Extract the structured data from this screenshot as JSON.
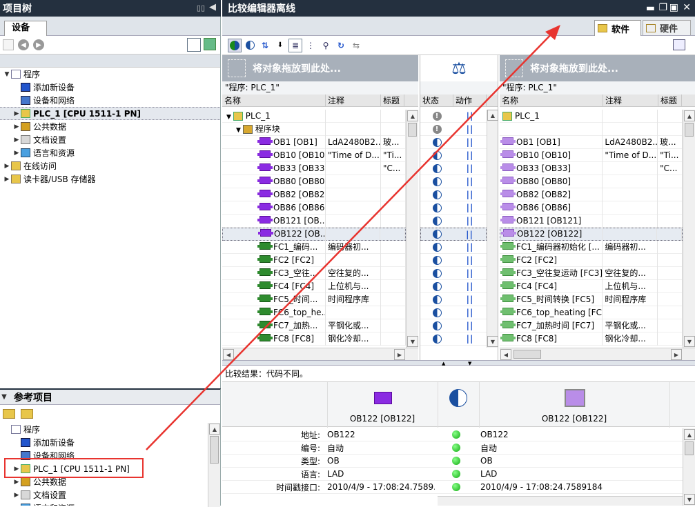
{
  "left_panel": {
    "title": "项目树",
    "tab": "设备",
    "tree": [
      {
        "label": "程序",
        "level": 0,
        "expanded": true
      },
      {
        "label": "添加新设备",
        "level": 1
      },
      {
        "label": "设备和网络",
        "level": 1
      },
      {
        "label": "PLC_1 [CPU 1511-1 PN]",
        "level": 1,
        "collapsed": true
      },
      {
        "label": "公共数据",
        "level": 1,
        "collapsed": true
      },
      {
        "label": "文档设置",
        "level": 1,
        "collapsed": true
      },
      {
        "label": "语言和资源",
        "level": 1,
        "collapsed": true
      },
      {
        "label": "在线访问",
        "level": 0,
        "collapsed": true
      },
      {
        "label": "读卡器/USB 存储器",
        "level": 0,
        "collapsed": true
      }
    ]
  },
  "ref_panel": {
    "title": "参考项目",
    "tree": [
      {
        "label": "程序",
        "level": 0
      },
      {
        "label": "添加新设备",
        "level": 1
      },
      {
        "label": "设备和网络",
        "level": 1
      },
      {
        "label": "PLC_1 [CPU 1511-1 PN]",
        "level": 1
      },
      {
        "label": "公共数据",
        "level": 1
      },
      {
        "label": "文档设置",
        "level": 1
      },
      {
        "label": "语言和资源",
        "level": 1
      }
    ]
  },
  "compare": {
    "title": "比较编辑器离线",
    "tab_software": "软件",
    "tab_hardware": "硬件",
    "drop_hint_left": "将对象拖放到此处...",
    "drop_hint_right": "将对象拖放到此处...",
    "left_path": "\"程序: PLC_1\"",
    "right_path": "\"程序: PLC_1\"",
    "col_name": "名称",
    "col_comment": "注释",
    "col_title": "标题",
    "col_status": "状态",
    "col_action": "动作",
    "left_rows": [
      {
        "name": "PLC_1",
        "type": "plc",
        "comment": "",
        "title": ""
      },
      {
        "name": "程序块",
        "type": "folder",
        "comment": "",
        "title": ""
      },
      {
        "name": "OB1 [OB1]",
        "type": "ob",
        "comment": "LdA2480B2...",
        "title": "玻..."
      },
      {
        "name": "OB10 [OB10]",
        "type": "ob",
        "comment": "\"Time of D...",
        "title": "\"Ti..."
      },
      {
        "name": "OB33 [OB33]",
        "type": "ob",
        "comment": "",
        "title": "\"C..."
      },
      {
        "name": "OB80 [OB80]",
        "type": "ob",
        "comment": "",
        "title": ""
      },
      {
        "name": "OB82 [OB82]",
        "type": "ob",
        "comment": "",
        "title": ""
      },
      {
        "name": "OB86 [OB86]",
        "type": "ob",
        "comment": "",
        "title": ""
      },
      {
        "name": "OB121 [OB...",
        "type": "ob",
        "comment": "",
        "title": ""
      },
      {
        "name": "OB122 [OB...",
        "type": "ob",
        "comment": "",
        "title": ""
      },
      {
        "name": "FC1_编码...",
        "type": "fc",
        "comment": "编码器初...",
        "title": ""
      },
      {
        "name": "FC2 [FC2]",
        "type": "fc",
        "comment": "",
        "title": ""
      },
      {
        "name": "FC3_空往...",
        "type": "fc",
        "comment": "空往复的...",
        "title": ""
      },
      {
        "name": "FC4 [FC4]",
        "type": "fc",
        "comment": "上位机与...",
        "title": ""
      },
      {
        "name": "FC5_时间...",
        "type": "fc",
        "comment": "时间程序库",
        "title": ""
      },
      {
        "name": "FC6_top_he...",
        "type": "fc",
        "comment": "",
        "title": ""
      },
      {
        "name": "FC7_加热...",
        "type": "fc",
        "comment": "平钢化或...",
        "title": ""
      },
      {
        "name": "FC8 [FC8]",
        "type": "fc",
        "comment": "钢化冷却...",
        "title": ""
      }
    ],
    "right_rows": [
      {
        "name": "PLC_1",
        "type": "plc",
        "comment": "",
        "title": ""
      },
      {
        "name": "",
        "type": "none",
        "comment": "",
        "title": ""
      },
      {
        "name": "OB1 [OB1]",
        "type": "ob",
        "comment": "LdA2480B2...",
        "title": "玻..."
      },
      {
        "name": "OB10 [OB10]",
        "type": "ob",
        "comment": "\"Time of D...",
        "title": "\"Ti..."
      },
      {
        "name": "OB33 [OB33]",
        "type": "ob",
        "comment": "",
        "title": "\"C..."
      },
      {
        "name": "OB80 [OB80]",
        "type": "ob",
        "comment": "",
        "title": ""
      },
      {
        "name": "OB82 [OB82]",
        "type": "ob",
        "comment": "",
        "title": ""
      },
      {
        "name": "OB86 [OB86]",
        "type": "ob",
        "comment": "",
        "title": ""
      },
      {
        "name": "OB121 [OB121]",
        "type": "ob",
        "comment": "",
        "title": ""
      },
      {
        "name": "OB122 [OB122]",
        "type": "ob",
        "comment": "",
        "title": ""
      },
      {
        "name": "FC1_编码器初始化 [...",
        "type": "fc",
        "comment": "编码器初...",
        "title": ""
      },
      {
        "name": "FC2 [FC2]",
        "type": "fc",
        "comment": "",
        "title": ""
      },
      {
        "name": "FC3_空往复运动 [FC3]",
        "type": "fc",
        "comment": "空往复的...",
        "title": ""
      },
      {
        "name": "FC4 [FC4]",
        "type": "fc",
        "comment": "上位机与...",
        "title": ""
      },
      {
        "name": "FC5_时间转换 [FC5]",
        "type": "fc",
        "comment": "时间程序库",
        "title": ""
      },
      {
        "name": "FC6_top_heating [FC6]",
        "type": "fc",
        "comment": "",
        "title": ""
      },
      {
        "name": "FC7_加热时间 [FC7]",
        "type": "fc",
        "comment": "平钢化或...",
        "title": ""
      },
      {
        "name": "FC8 [FC8]",
        "type": "fc",
        "comment": "钢化冷却...",
        "title": ""
      }
    ],
    "status_rows": [
      "warn",
      "warn",
      "half",
      "half",
      "half",
      "half",
      "half",
      "half",
      "half",
      "half",
      "half",
      "half",
      "half",
      "half",
      "half",
      "half",
      "half",
      "half"
    ],
    "action_symbol": "||"
  },
  "result": {
    "label": "比较结果：代码不同。",
    "left_block": "OB122 [OB122]",
    "right_block": "OB122 [OB122]",
    "props": [
      {
        "key": "地址:",
        "left": "OB122",
        "right": "OB122"
      },
      {
        "key": "编号:",
        "left": "自动",
        "right": "自动"
      },
      {
        "key": "类型:",
        "left": "OB",
        "right": "OB"
      },
      {
        "key": "语言:",
        "left": "LAD",
        "right": "LAD"
      },
      {
        "key": "时间戳接口:",
        "left": "2010/4/9 - 17:08:24.7589...",
        "right": "2010/4/9 - 17:08:24.7589184"
      }
    ]
  },
  "colors": {
    "header": "#24303f",
    "annotation": "#e8342f"
  }
}
